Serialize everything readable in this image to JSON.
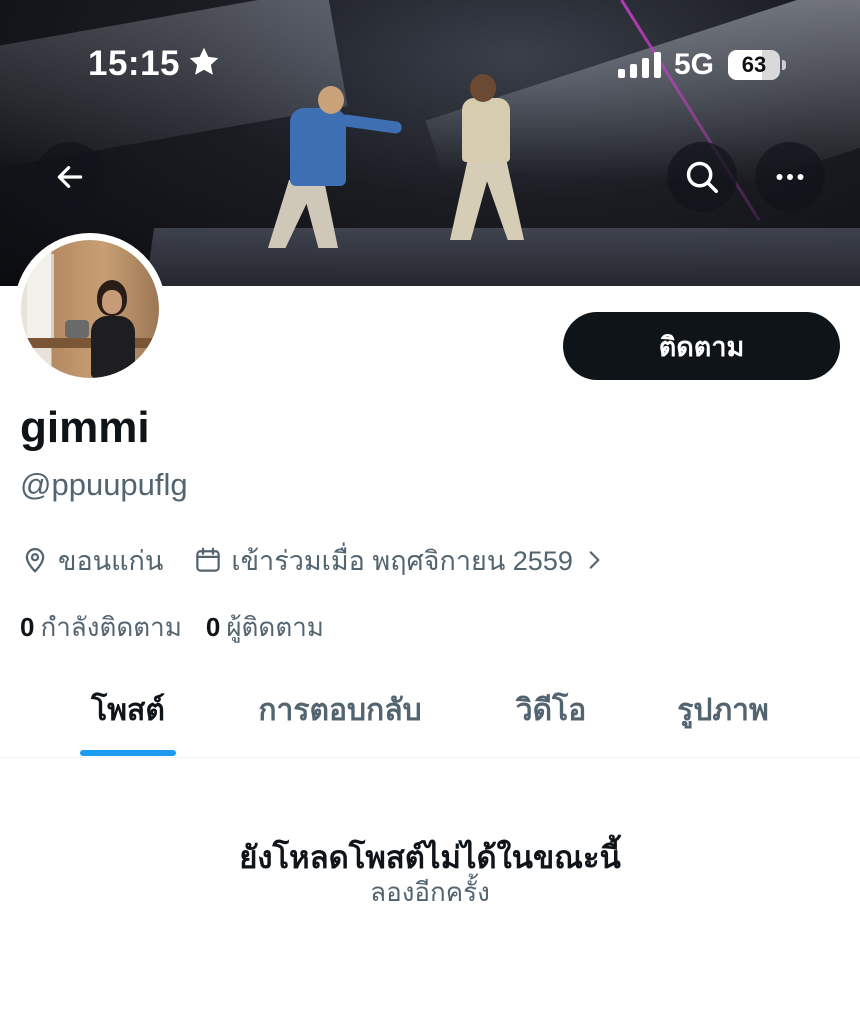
{
  "status_bar": {
    "time": "15:15",
    "network": "5G",
    "battery": "63"
  },
  "header": {
    "back_icon": "arrow-left-icon",
    "search_icon": "search-icon",
    "more_icon": "more-horizontal-icon"
  },
  "profile": {
    "display_name": "gimmi",
    "handle": "@ppuupuflg",
    "follow_label": "ติดตาม",
    "location": "ขอนแก่น",
    "joined": "เข้าร่วมเมื่อ พฤศจิกายน 2559",
    "following_count": "0",
    "following_label": "กำลังติดตาม",
    "followers_count": "0",
    "followers_label": "ผู้ติดตาม"
  },
  "tabs": [
    {
      "label": "โพสต์",
      "active": true
    },
    {
      "label": "การตอบกลับ",
      "active": false
    },
    {
      "label": "วิดีโอ",
      "active": false
    },
    {
      "label": "รูปภาพ",
      "active": false
    }
  ],
  "empty_state": {
    "title": "ยังโหลดโพสต์ไม่ได้ในขณะนี้",
    "subtitle": "ลองอีกครั้ง"
  },
  "colors": {
    "accent": "#1d9bf0",
    "text_primary": "#0f1419",
    "text_secondary": "#536471"
  }
}
